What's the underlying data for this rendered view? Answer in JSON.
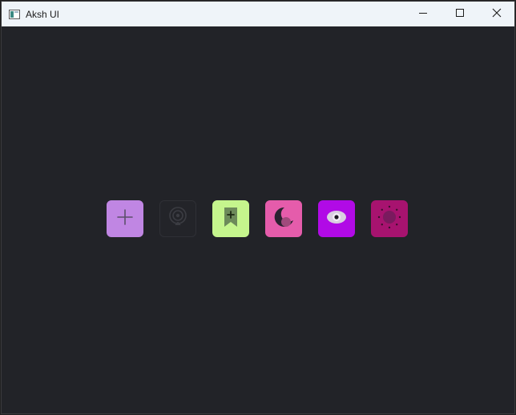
{
  "window": {
    "title": "Aksh UI"
  },
  "titlebar": {
    "app_icon": "app-window-icon",
    "controls": [
      "minimize-icon",
      "maximize-icon",
      "close-icon"
    ]
  },
  "toolbar": {
    "buttons": [
      {
        "name": "add",
        "icon": "plus-icon",
        "color": "#c086e3"
      },
      {
        "name": "podcast",
        "icon": "podcast-icon",
        "color": "#232429"
      },
      {
        "name": "bookmark",
        "icon": "bookmark-plus-icon",
        "color": "#c5f58d"
      },
      {
        "name": "moon",
        "icon": "moon-icon",
        "color": "#e55cab"
      },
      {
        "name": "eye",
        "icon": "eye-icon",
        "color": "#b10ae6"
      },
      {
        "name": "sun",
        "icon": "sun-icon",
        "color": "#a7136f"
      }
    ]
  },
  "colors": {
    "background": "#222328",
    "titlebar": "#eff4f9"
  }
}
